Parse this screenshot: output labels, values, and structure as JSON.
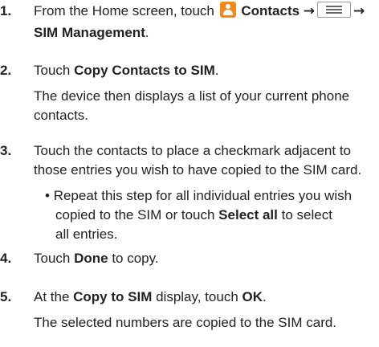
{
  "steps": [
    {
      "num": "1.",
      "pre": "From the Home screen, touch ",
      "b1": "Contacts",
      "arrow1": "→",
      "arrow2": "→",
      "b2": "SIM Management",
      "post": "."
    },
    {
      "num": "2.",
      "pre": "Touch ",
      "b1": "Copy Contacts to SIM",
      "post": ".",
      "sub_line1": "The device then displays a list of your current phone",
      "sub_line2": "contacts."
    },
    {
      "num": "3.",
      "line1": "Touch the contacts to place a checkmark adjacent to",
      "line2": "those entries you wish to have copied to the SIM card.",
      "bullet": {
        "mark": "•",
        "line1": "Repeat this step for all individual entries you wish",
        "line2_pre": "copied to the SIM or touch ",
        "line2_bold": "Select all",
        "line2_post": " to select",
        "line3": "all entries."
      }
    },
    {
      "num": "4.",
      "pre": "Touch ",
      "b1": "Done",
      "post": " to copy."
    },
    {
      "num": "5.",
      "pre": "At the ",
      "b1": "Copy to SIM",
      "mid": " display, touch ",
      "b2": "OK",
      "post": ".",
      "sub_line1": "The selected numbers are copied to the SIM card."
    }
  ],
  "icons": {
    "contacts": "contacts-icon",
    "menu": "menu-key-icon",
    "contacts_color": "#f08a1c"
  }
}
